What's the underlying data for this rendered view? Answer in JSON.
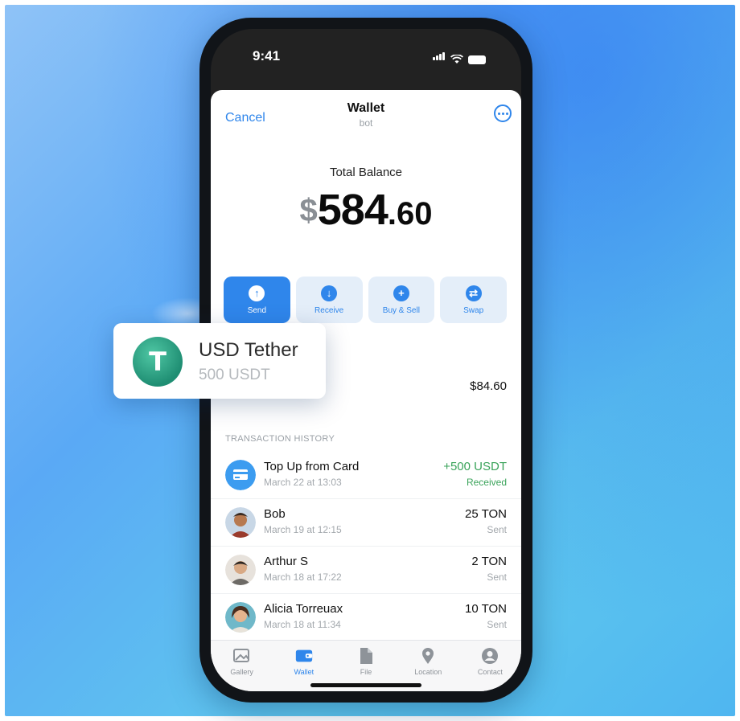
{
  "status_bar": {
    "time": "9:41"
  },
  "nav": {
    "cancel": "Cancel",
    "title": "Wallet",
    "subtitle": "bot",
    "more_icon": "ellipsis-circle-icon"
  },
  "balance": {
    "label": "Total Balance",
    "currency": "$",
    "integer": "584",
    "decimal": ".60"
  },
  "actions": [
    {
      "label": "Send",
      "icon": "arrow-up-icon"
    },
    {
      "label": "Receive",
      "icon": "arrow-down-icon"
    },
    {
      "label": "Buy & Sell",
      "icon": "plus-icon"
    },
    {
      "label": "Swap",
      "icon": "swap-icon"
    }
  ],
  "asset": {
    "name": "USD Tether",
    "amount": "500 USDT",
    "value": "$84.60",
    "symbol": "T"
  },
  "tx_header": "TRANSACTION HISTORY",
  "transactions": [
    {
      "name": "Top Up from Card",
      "date": "March 22 at 13:03",
      "amount": "+500 USDT",
      "status": "Received"
    },
    {
      "name": "Bob",
      "date": "March 19 at 12:15",
      "amount": "25 TON",
      "status": "Sent"
    },
    {
      "name": "Arthur S",
      "date": "March 18 at 17:22",
      "amount": "2 TON",
      "status": "Sent"
    },
    {
      "name": "Alicia Torreuax",
      "date": "March 18 at 11:34",
      "amount": "10 TON",
      "status": "Sent"
    }
  ],
  "tabs": [
    {
      "label": "Gallery",
      "icon": "gallery-icon"
    },
    {
      "label": "Wallet",
      "icon": "wallet-icon"
    },
    {
      "label": "File",
      "icon": "file-icon"
    },
    {
      "label": "Location",
      "icon": "location-icon"
    },
    {
      "label": "Contact",
      "icon": "contact-icon"
    }
  ],
  "colors": {
    "accent": "#2f86eb",
    "positive": "#3aa35a",
    "tether": "#26a17b"
  }
}
